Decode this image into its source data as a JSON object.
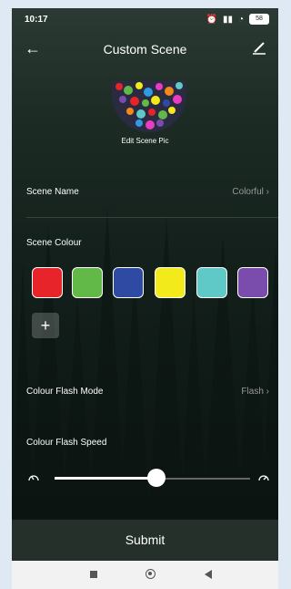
{
  "status": {
    "time": "10:17",
    "battery": "58"
  },
  "header": {
    "title": "Custom Scene"
  },
  "scene_pic": {
    "label": "Edit Scene Pic"
  },
  "scene_name": {
    "label": "Scene Name",
    "value": "Colorful"
  },
  "scene_colour": {
    "label": "Scene Colour",
    "colors": [
      "#e8242b",
      "#62b948",
      "#2f4aa3",
      "#f2ea1a",
      "#5ec9c7",
      "#7a4cab"
    ],
    "add_label": "+"
  },
  "flash_mode": {
    "label": "Colour Flash Mode",
    "value": "Flash"
  },
  "flash_speed": {
    "label": "Colour Flash Speed",
    "value_fraction": 0.52
  },
  "submit": {
    "label": "Submit"
  }
}
